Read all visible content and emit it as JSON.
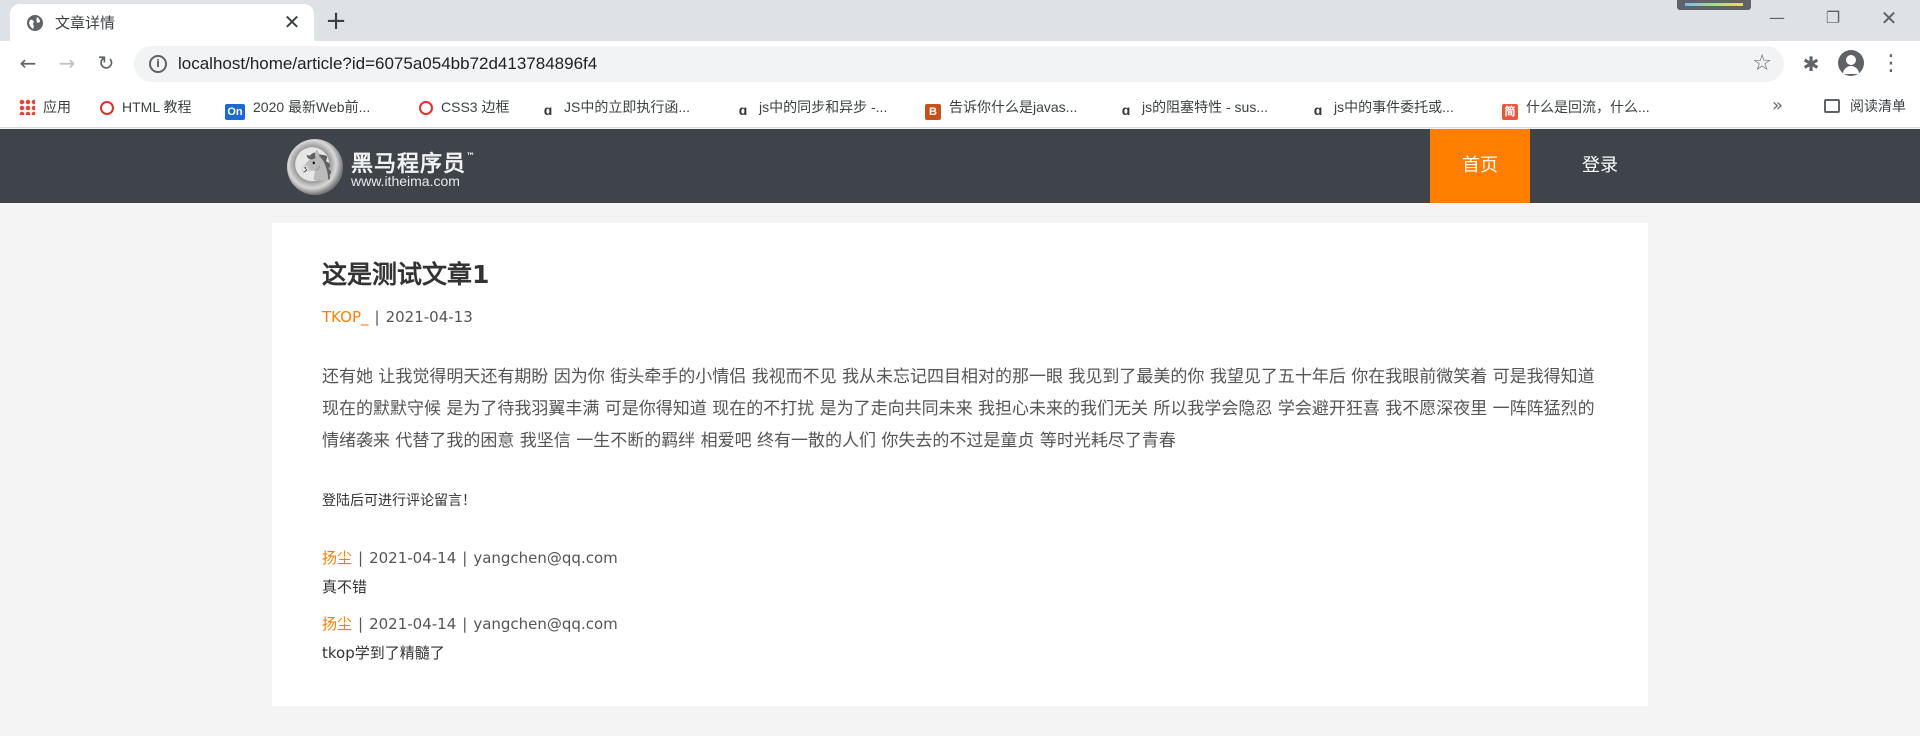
{
  "browser": {
    "tab_title": "文章详情",
    "url": "localhost/home/article?id=6075a054bb72d413784896f4",
    "bookmarks": [
      {
        "label": "应用",
        "icon": "apps-grid-icon"
      },
      {
        "label": "HTML 教程",
        "icon": "runoob-icon"
      },
      {
        "label": "2020 最新Web前...",
        "icon": "on-icon"
      },
      {
        "label": "CSS3 边框",
        "icon": "runoob-icon"
      },
      {
        "label": "JS中的立即执行函...",
        "icon": "csdn-icon"
      },
      {
        "label": "js中的同步和异步 -...",
        "icon": "csdn-icon"
      },
      {
        "label": "告诉你什么是javas...",
        "icon": "bookmark-b-icon"
      },
      {
        "label": "js的阻塞特性 - sus...",
        "icon": "csdn-icon"
      },
      {
        "label": "js中的事件委托或...",
        "icon": "csdn-icon"
      },
      {
        "label": "什么是回流，什么...",
        "icon": "jianshu-icon"
      }
    ],
    "reading_list": "阅读清单"
  },
  "site": {
    "logo_text": "黑马程序员",
    "logo_tm": "™",
    "logo_sub": "www.itheima.com",
    "nav": {
      "home": "首页",
      "login": "登录"
    }
  },
  "article": {
    "title": "这是测试文章1",
    "author": "TKOP_",
    "separator": "|",
    "date": "2021-04-13",
    "content": "还有她 让我觉得明天还有期盼 因为你 街头牵手的小情侣 我视而不见 我从未忘记四目相对的那一眼 我见到了最美的你 我望见了五十年后 你在我眼前微笑着 可是我得知道 现在的默默守候 是为了待我羽翼丰满 可是你得知道 现在的不打扰 是为了走向共同未来 我担心未来的我们无关 所以我学会隐忍 学会避开狂喜 我不愿深夜里 一阵阵猛烈的情绪袭来 代替了我的困意 我坚信 一生不断的羁绊 相爱吧 终有一散的人们 你失去的不过是童贞 等时光耗尽了青春",
    "login_tip": "登陆后可进行评论留言！"
  },
  "comments": [
    {
      "user": "扬尘",
      "date": "2021-04-14",
      "email": "yangchen@qq.com",
      "text": "真不错"
    },
    {
      "user": "扬尘",
      "date": "2021-04-14",
      "email": "yangchen@qq.com",
      "text": "tkop学到了精髓了"
    }
  ],
  "colors": {
    "accent": "#ff7e00",
    "header_bg": "#3f434a"
  }
}
